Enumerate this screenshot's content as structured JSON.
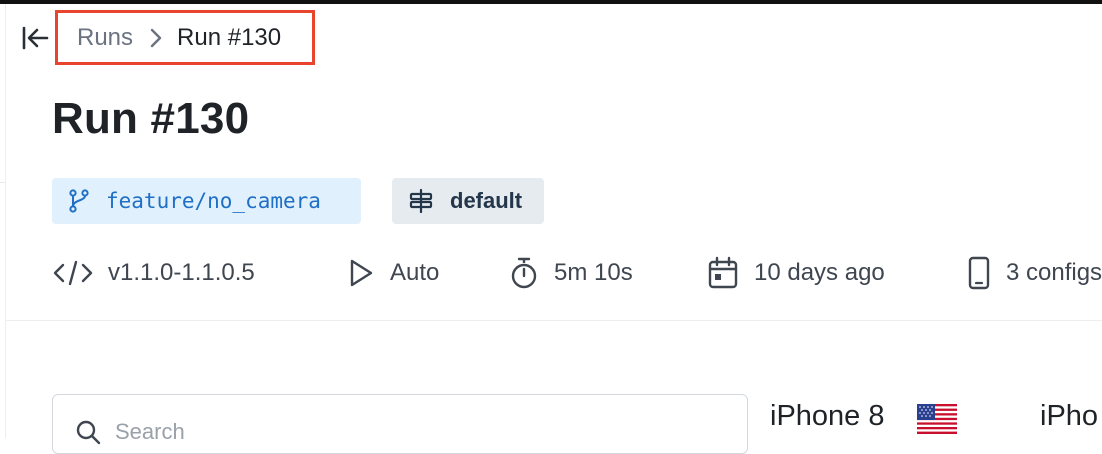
{
  "breadcrumb": {
    "parent": "Runs",
    "current": "Run #130"
  },
  "page": {
    "title": "Run #130"
  },
  "badges": {
    "branch": "feature/no_camera",
    "environment": "default"
  },
  "meta": {
    "version": "v1.1.0-1.1.0.5",
    "trigger": "Auto",
    "duration": "5m 10s",
    "date": "10 days ago",
    "configs": "3 configs"
  },
  "search": {
    "placeholder": "Search"
  },
  "devices": [
    {
      "name": "iPhone 8",
      "flag": "us-flag"
    },
    {
      "name": "iPho"
    }
  ],
  "colors": {
    "highlight_border": "#e8442e",
    "branch_badge_bg": "#e0f0fc",
    "branch_badge_text": "#1f6fc5",
    "env_badge_bg": "#e6ebef"
  }
}
